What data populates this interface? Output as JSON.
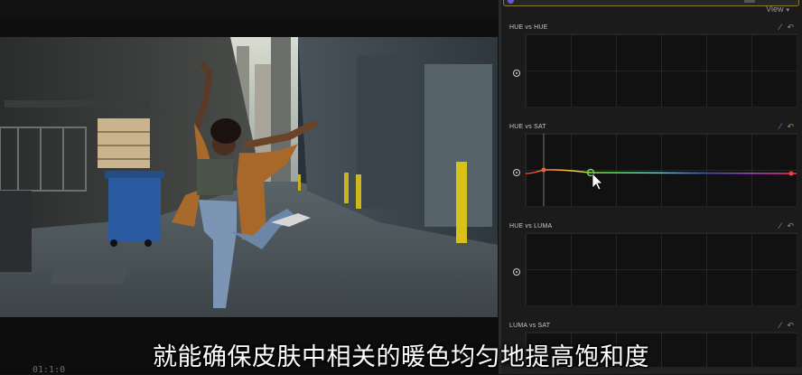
{
  "viewer": {
    "timecode": "01:1:0"
  },
  "subtitle": "就能确保皮肤中相关的暖色均匀地提高饱和度",
  "inspector": {
    "view_menu": "View",
    "sections": [
      {
        "title": "HUE vs HUE"
      },
      {
        "title": "HUE vs SAT"
      },
      {
        "title": "HUE vs LUMA"
      },
      {
        "title": "LUMA vs SAT"
      }
    ]
  },
  "colors": {
    "accent": "#6f73ff",
    "header_outline": "#8a7a2a",
    "control_point_orange": "#e06a3a",
    "control_point_green": "#6ad66a",
    "endpoint_red": "#ff3b3b"
  },
  "icons": [
    "eyedropper-icon",
    "reset-arrow-icon",
    "reset-dot-icon",
    "mouse-cursor-icon",
    "chevron-down-icon"
  ]
}
